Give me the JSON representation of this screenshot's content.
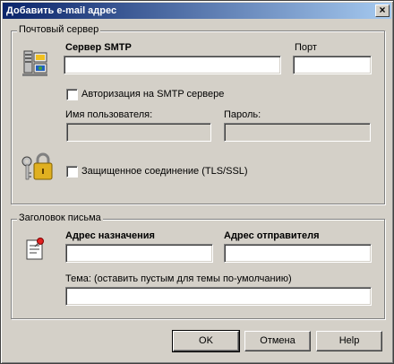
{
  "window": {
    "title": "Добавить e-mail адрес",
    "close_glyph": "×"
  },
  "mail_server": {
    "group_label": "Почтовый сервер",
    "smtp_server_label": "Сервер SMTP",
    "smtp_server_value": "",
    "port_label": "Порт",
    "port_value": "",
    "auth_checkbox_label": "Авторизация на SMTP сервере",
    "auth_checked": false,
    "username_label": "Имя пользователя:",
    "username_value": "",
    "password_label": "Пароль:",
    "password_value": "",
    "secure_checkbox_label": "Защищенное соединение (TLS/SSL)",
    "secure_checked": false
  },
  "letter_header": {
    "group_label": "Заголовок письма",
    "to_label": "Адрес назначения",
    "to_value": "",
    "from_label": "Адрес отправителя",
    "from_value": "",
    "subject_label": "Тема: (оставить пустым для темы по-умолчанию)",
    "subject_value": ""
  },
  "buttons": {
    "ok": "OK",
    "cancel": "Отмена",
    "help": "Help"
  },
  "icons": {
    "server": "server-computers-icon",
    "lock": "padlock-keys-icon",
    "letter": "letter-pin-icon",
    "close": "close-icon"
  },
  "colors": {
    "face": "#d4d0c8",
    "title_start": "#0a246a",
    "title_end": "#a6caf0"
  }
}
